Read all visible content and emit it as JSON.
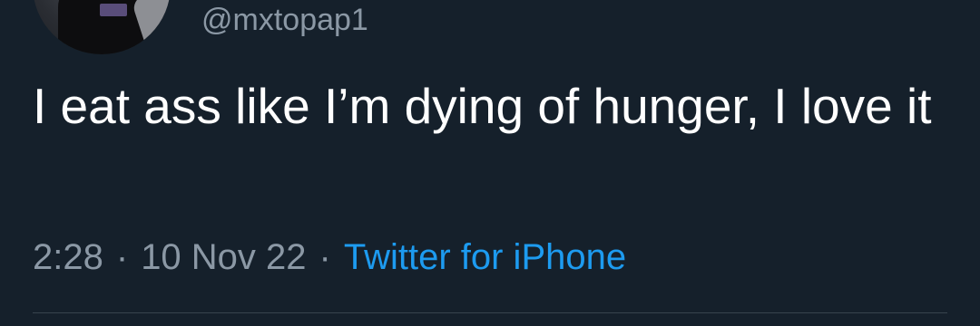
{
  "tweet": {
    "handle": "@mxtopap1",
    "text": "I eat ass like I’m dying of hunger, I love it",
    "time": "2:28",
    "date": "10 Nov 22",
    "separator": "·",
    "source": "Twitter for iPhone"
  },
  "colors": {
    "background": "#15202b",
    "text": "#ffffff",
    "muted": "#8b98a5",
    "link": "#1d9bf0",
    "divider": "#38444d"
  }
}
